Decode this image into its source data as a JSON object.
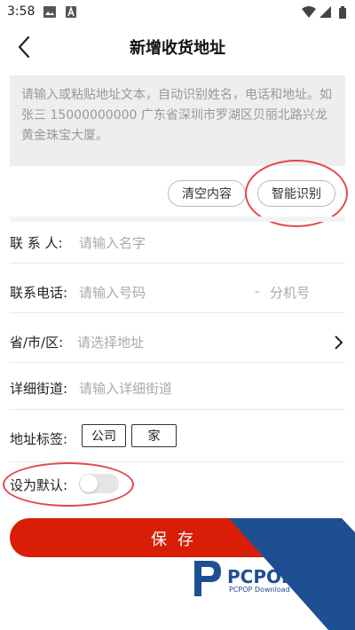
{
  "status": {
    "time": "3:58",
    "icons": [
      "image-icon",
      "a-badge-icon",
      "wifi-icon",
      "signal-icon",
      "battery-icon"
    ]
  },
  "header": {
    "title": "新增收货地址",
    "back_icon": "back-arrow-icon"
  },
  "paste_box": {
    "placeholder": "请输入或粘贴地址文本，自动识别姓名，电话和地址。如张三 15000000000 广东省深圳市罗湖区贝丽北路兴龙黄金珠宝大厦。"
  },
  "actions": {
    "clear_label": "清空内容",
    "recognize_label": "智能识别"
  },
  "form": {
    "contact": {
      "label": "联 系 人:",
      "placeholder": "请输入名字"
    },
    "phone": {
      "label": "联系电话:",
      "placeholder": "请输入号码",
      "ext_prefix": "-",
      "ext_placeholder": "分机号"
    },
    "region": {
      "label": "省/市/区:",
      "placeholder": "请选择地址"
    },
    "street": {
      "label": "详细街道:",
      "placeholder": "请输入详细街道"
    },
    "tags": {
      "label": "地址标签:",
      "options": [
        "公司",
        "家"
      ]
    },
    "default": {
      "label": "设为默认:",
      "enabled": false
    }
  },
  "save": {
    "label": "保存"
  },
  "watermark": {
    "brand": "PCPOP下载",
    "sub": "PCPOP Download"
  },
  "colors": {
    "accent_red": "#d81e06",
    "annotation_red": "#e24a4a",
    "watermark_blue": "#1f4f93"
  }
}
